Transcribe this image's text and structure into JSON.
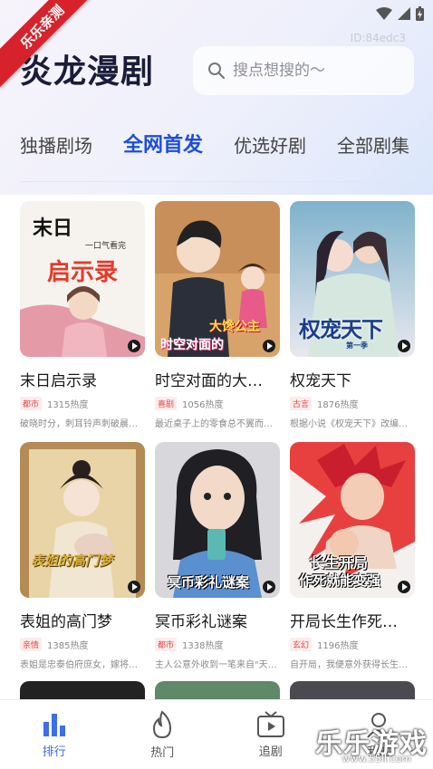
{
  "status": {
    "icons": [
      "wifi-icon",
      "signal-icon",
      "battery-icon"
    ]
  },
  "ribbon": "乐乐亲测",
  "id_tag": "ID:84edc3",
  "app": {
    "title": "炎龙漫剧"
  },
  "search": {
    "placeholder": "搜点想搜的～",
    "icon": "search-icon"
  },
  "tabs": [
    {
      "label": "独播剧场",
      "active": false
    },
    {
      "label": "全网首发",
      "active": true
    },
    {
      "label": "优选好剧",
      "active": false
    },
    {
      "label": "全部剧集",
      "active": false
    }
  ],
  "dramas": [
    {
      "title": "末日启示录",
      "tag": "都市",
      "heat": "1315热度",
      "desc": "破晓时分，刺耳铃声刺破晨…",
      "cover_text": [
        "末日",
        "一口气看完",
        "启示录"
      ]
    },
    {
      "title": "时空对面的大…",
      "tag": "喜剧",
      "heat": "1056热度",
      "desc": "最近桌子上的零食总不翼而…",
      "cover_text": [
        "大馋公主",
        "时空对面的"
      ]
    },
    {
      "title": "权宠天下",
      "tag": "古言",
      "heat": "1876热度",
      "desc": "根据小说《权宠天下》改编…",
      "cover_text": [
        "权宠天下",
        "第一季"
      ]
    },
    {
      "title": "表姐的高门梦",
      "tag": "亲情",
      "heat": "1385热度",
      "desc": "表姐是忠泰伯府庶女，嫁将…",
      "cover_text": [
        "表姐的高门梦"
      ]
    },
    {
      "title": "冥币彩礼谜案",
      "tag": "都市",
      "heat": "1338热度",
      "desc": "主人公意外收到一笔来自\"天…",
      "cover_text": [
        "冥币彩礼谜案"
      ]
    },
    {
      "title": "开局长生作死…",
      "tag": "玄幻",
      "heat": "1196热度",
      "desc": "自开局，我便意外获得长生…",
      "cover_text": [
        "长生开局",
        "作死就能变强"
      ]
    }
  ],
  "nav": [
    {
      "label": "排行",
      "icon": "ranking-icon",
      "active": true
    },
    {
      "label": "热门",
      "icon": "flame-icon",
      "active": false
    },
    {
      "label": "追剧",
      "icon": "tv-icon",
      "active": false
    },
    {
      "label": "我的",
      "icon": "profile-icon",
      "active": false
    }
  ],
  "watermark": {
    "main": "乐乐游戏",
    "sub": "www.55ll.com"
  },
  "colors": {
    "accent": "#1d4ed8",
    "tag_red": "#e24a4a",
    "title": "#1a1c3a"
  }
}
